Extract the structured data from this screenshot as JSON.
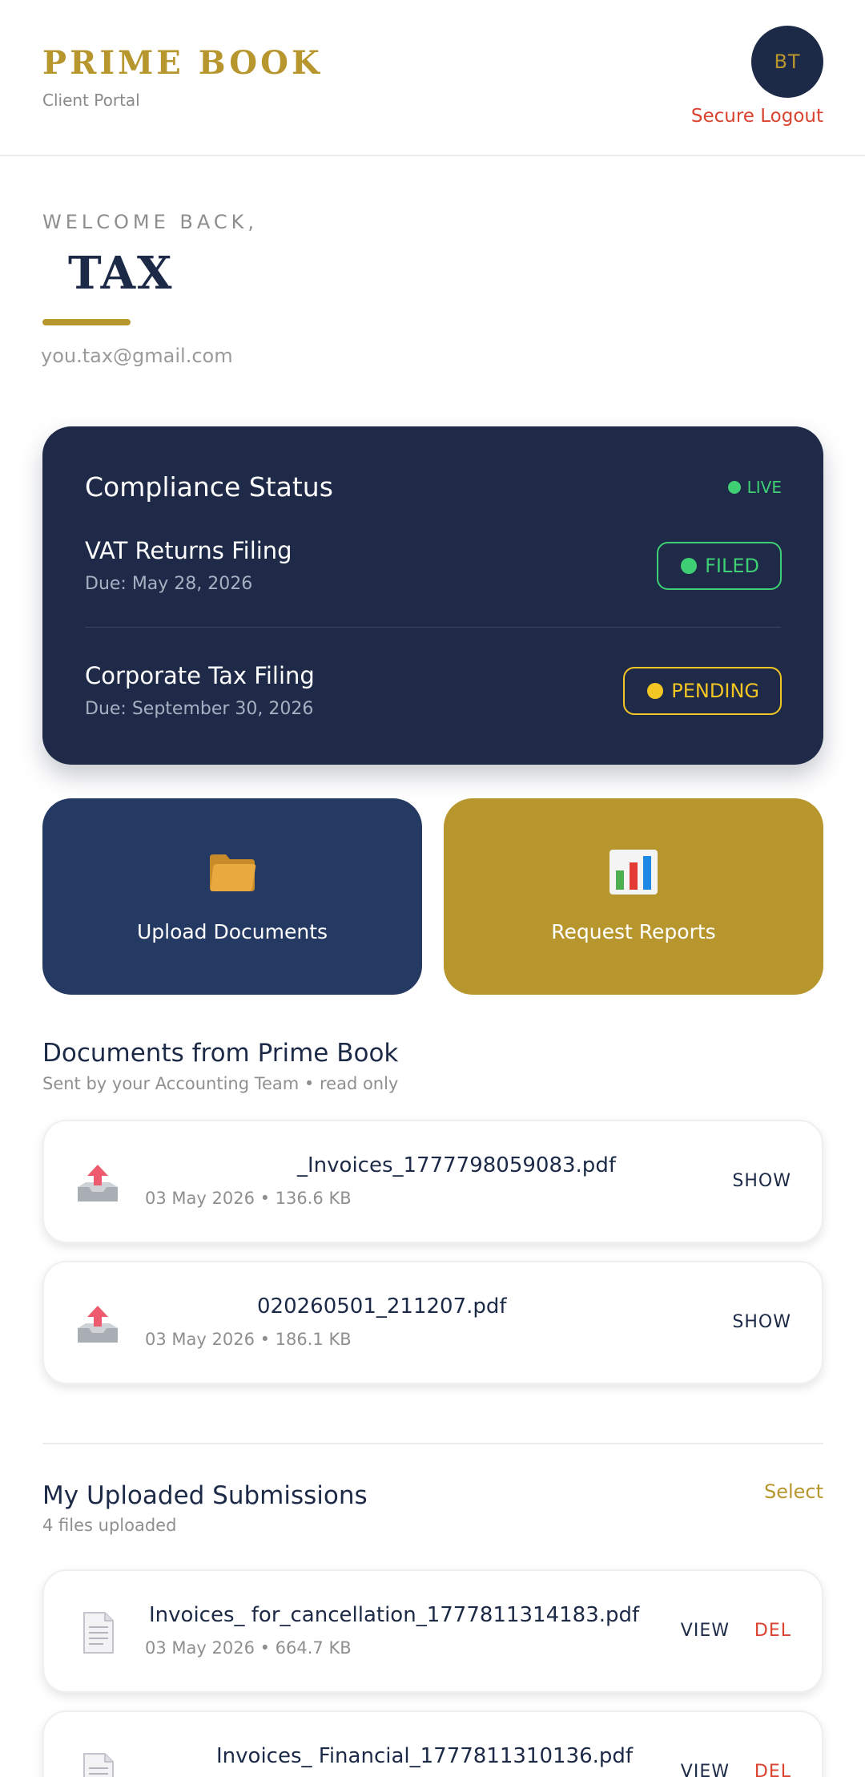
{
  "header": {
    "brand": "PRIME BOOK",
    "subtitle": "Client Portal",
    "avatar_initials": "BT",
    "logout_label": "Secure Logout"
  },
  "welcome": {
    "greeting": "WELCOME BACK,",
    "name": "TAX",
    "email": "you.tax@gmail.com"
  },
  "compliance": {
    "title": "Compliance Status",
    "live_label": "LIVE",
    "items": [
      {
        "name": "VAT Returns Filing",
        "due": "Due: May 28, 2026",
        "status": "FILED"
      },
      {
        "name": "Corporate Tax Filing",
        "due": "Due: September 30, 2026",
        "status": "PENDING"
      }
    ]
  },
  "actions": {
    "upload_label": "Upload Documents",
    "report_label": "Request Reports"
  },
  "received": {
    "title": "Documents from Prime Book",
    "subtitle": "Sent by your Accounting Team • read only",
    "files": [
      {
        "name": "_Invoices_1777798059083.pdf",
        "meta": "03 May 2026 • 136.6 KB",
        "action": "SHOW"
      },
      {
        "name": "020260501_211207.pdf",
        "meta": "03 May 2026 • 186.1 KB",
        "action": "SHOW"
      }
    ]
  },
  "uploaded": {
    "title": "My Uploaded Submissions",
    "subtitle": "4 files uploaded",
    "select_label": "Select",
    "files": [
      {
        "name": "Invoices_ for_cancellation_1777811314183.pdf",
        "meta": "03 May 2026 • 664.7 KB",
        "view": "VIEW",
        "del": "DEL"
      },
      {
        "name": "Invoices_ Financial_1777811310136.pdf",
        "meta": "",
        "view": "VIEW",
        "del": "DEL"
      }
    ]
  },
  "colors": {
    "navy": "#1e2a47",
    "gold": "#b8962e",
    "green": "#3ecf74",
    "yellow": "#f3c623",
    "red": "#d9432f"
  }
}
